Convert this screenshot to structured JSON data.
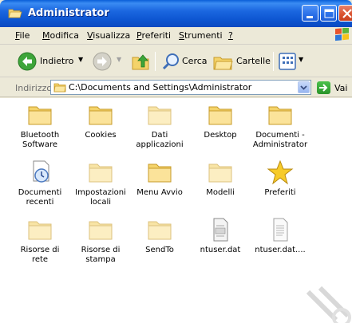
{
  "window": {
    "title": "Administrator",
    "title_icon": "folder-open-icon"
  },
  "menubar": {
    "items": [
      {
        "label": "File",
        "accel": "F",
        "rest": "ile"
      },
      {
        "label": "Modifica",
        "accel": "M",
        "rest": "odifica"
      },
      {
        "label": "Visualizza",
        "accel": "V",
        "rest": "isualizza"
      },
      {
        "label": "Preferiti",
        "accel": "P",
        "rest": "referiti"
      },
      {
        "label": "Strumenti",
        "accel": "S",
        "rest": "trumenti"
      },
      {
        "label": "?",
        "accel": "?",
        "rest": ""
      }
    ]
  },
  "toolbar": {
    "back_label": "Indietro",
    "search_label": "Cerca",
    "folders_label": "Cartelle"
  },
  "address": {
    "label": "Indirizzo",
    "label_accel": "d",
    "path": "C:\\Documents and Settings\\Administrator",
    "go_label": "Vai"
  },
  "items": [
    {
      "label": "Bluetooth\nSoftware",
      "icon": "folder-icon"
    },
    {
      "label": "Cookies",
      "icon": "folder-icon"
    },
    {
      "label": "Dati\napplicazioni",
      "icon": "folder-icon"
    },
    {
      "label": "Desktop",
      "icon": "folder-icon"
    },
    {
      "label": "Documenti -\nAdministrator",
      "icon": "folder-icon"
    },
    {
      "label": "Documenti\nrecenti",
      "icon": "recent-documents-icon"
    },
    {
      "label": "Impostazioni\nlocali",
      "icon": "folder-icon"
    },
    {
      "label": "Menu Avvio",
      "icon": "folder-icon"
    },
    {
      "label": "Modelli",
      "icon": "folder-icon"
    },
    {
      "label": "Preferiti",
      "icon": "favorites-star-icon"
    },
    {
      "label": "Risorse di rete",
      "icon": "folder-icon"
    },
    {
      "label": "Risorse di\nstampa",
      "icon": "folder-icon"
    },
    {
      "label": "SendTo",
      "icon": "folder-icon"
    },
    {
      "label": "ntuser.dat",
      "icon": "dat-file-icon"
    },
    {
      "label": "ntuser.dat....",
      "icon": "text-file-icon"
    }
  ],
  "colors": {
    "titlebar": "#0c54d0",
    "chrome": "#ece9d8",
    "folder": "#f4d36a"
  }
}
